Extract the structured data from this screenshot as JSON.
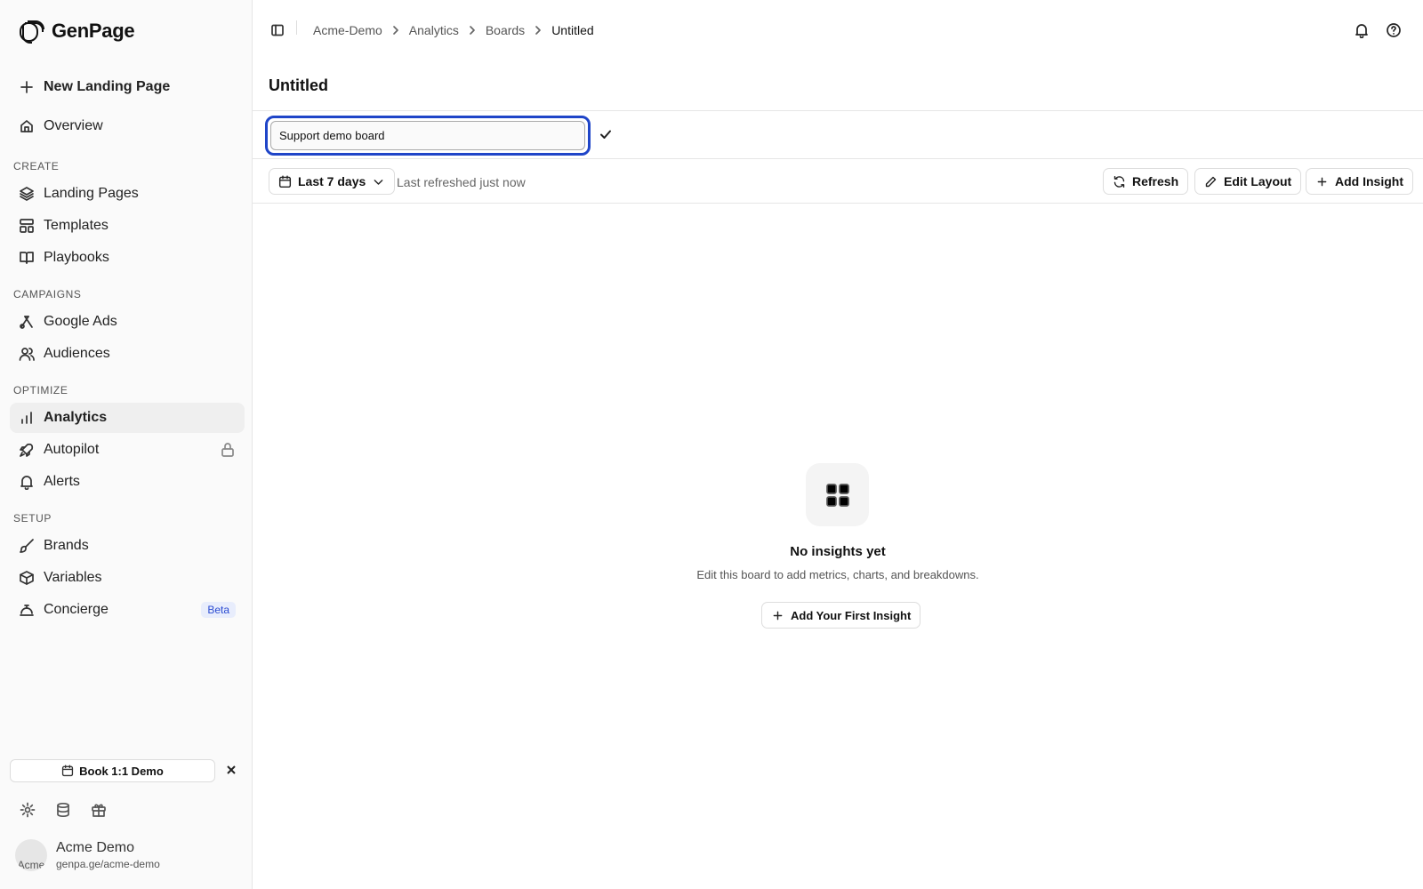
{
  "app": {
    "brand": "GenPage"
  },
  "sidebar": {
    "new_page": "New Landing Page",
    "overview": "Overview",
    "sections": {
      "create": "CREATE",
      "campaigns": "CAMPAIGNS",
      "optimize": "OPTIMIZE",
      "setup": "SETUP"
    },
    "items": {
      "landing_pages": "Landing Pages",
      "templates": "Templates",
      "playbooks": "Playbooks",
      "google_ads": "Google Ads",
      "audiences": "Audiences",
      "analytics": "Analytics",
      "autopilot": "Autopilot",
      "alerts": "Alerts",
      "brands": "Brands",
      "variables": "Variables",
      "concierge": "Concierge"
    },
    "concierge_badge": "Beta",
    "active_item": "analytics",
    "demo_button": "Book 1:1 Demo",
    "account": {
      "name": "Acme Demo",
      "url": "genpa.ge/acme-demo",
      "avatar_alt": "Acme"
    }
  },
  "breadcrumb": [
    "Acme-Demo",
    "Analytics",
    "Boards",
    "Untitled"
  ],
  "page": {
    "title": "Untitled",
    "title_input_value": "Support demo board"
  },
  "toolbar": {
    "date_range": "Last 7 days",
    "refreshed": "Last refreshed just now",
    "refresh": "Refresh",
    "edit_layout": "Edit Layout",
    "add_insight": "Add Insight"
  },
  "empty_state": {
    "title": "No insights yet",
    "subtitle": "Edit this board to add metrics, charts, and breakdowns.",
    "cta": "Add Your First Insight"
  },
  "colors": {
    "focus_ring": "#1f45c8",
    "badge_text": "#2b4bd1",
    "badge_bg": "#e8edfc"
  }
}
